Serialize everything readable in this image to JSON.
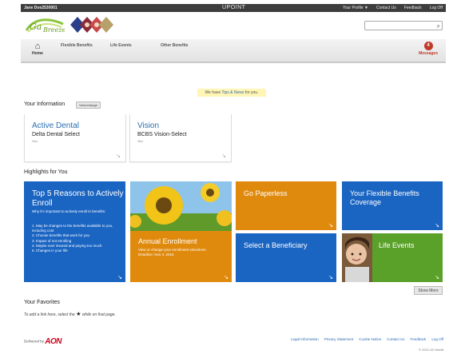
{
  "topbar": {
    "user": "Jane Doe2530001",
    "brand": "UPOINT",
    "links": [
      "Your Profile ▼",
      "Contact Us",
      "Feedback",
      "Log Off"
    ]
  },
  "logo": {
    "text": "Ga Breeze"
  },
  "search": {
    "placeholder": "",
    "icon": "search-icon"
  },
  "nav": {
    "home_label": "Home",
    "items": [
      "Flexible Benefits",
      "Life Events",
      "Other Benefits"
    ],
    "messages_label": "Messages",
    "messages_count": "4"
  },
  "notice": {
    "prefix": "We have",
    "link": "Tips & News",
    "suffix": "for you."
  },
  "your_information": {
    "title": "Your Information",
    "button": "View/change",
    "cards": [
      {
        "title": "Active Dental",
        "plan": "Delta Dental Select",
        "who": "You"
      },
      {
        "title": "Vision",
        "plan": "BCBS Vision-Select",
        "who": "You"
      }
    ]
  },
  "highlights": {
    "title": "Highlights for You",
    "tiles": {
      "reasons": {
        "title": "Top 5 Reasons to Actively Enroll",
        "subtitle": "Why it's important to actively enroll in benefits:",
        "items": [
          "1.  May be changes to the benefits available to you, including cost",
          "2.  Choose benefits that work for you",
          "3.  Impact of not enrolling",
          "4.  Maybe over insured and paying too much",
          "5.  Changes in your life"
        ]
      },
      "annual": {
        "title": "Annual Enrollment",
        "desc": "View or change your enrollment selections. Deadline: Nov 4, 2016"
      },
      "paperless": {
        "title": "Go Paperless"
      },
      "coverage": {
        "title": "Your Flexible Benefits Coverage"
      },
      "beneficiary": {
        "title": "Select a Beneficiary"
      },
      "life_events": {
        "title": "Life Events"
      }
    },
    "show_more": "Show More"
  },
  "favorites": {
    "title": "Your Favorites",
    "hint_before": "To add a link here, select the",
    "hint_after": "while on that page."
  },
  "footer": {
    "delivered_by": "Delivered by",
    "brand": "AON",
    "links": [
      "Legal Information",
      "Privacy Statement",
      "Cookie Notice",
      "Contact Us",
      "Feedback",
      "Log Off"
    ],
    "copyright": "© 2012-16 Hewitt"
  },
  "colors": {
    "blue": "#1a64c2",
    "orange": "#e08a0d",
    "green": "#5aa12a",
    "messages": "#c0392b"
  }
}
